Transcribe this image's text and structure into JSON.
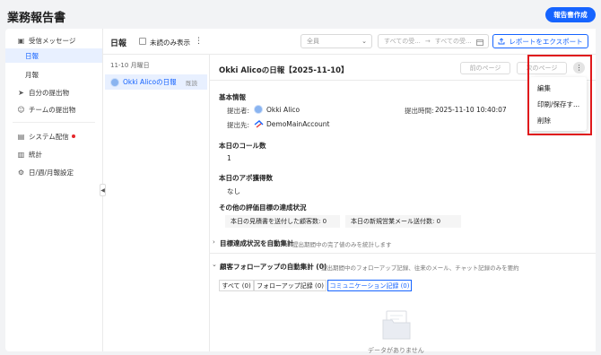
{
  "app": {
    "title": "業務報告書",
    "report_button": "報告書作成"
  },
  "sidebar": {
    "items": [
      {
        "label": "受信メッセージ",
        "icon": "inbox-icon"
      },
      {
        "label": "日報"
      },
      {
        "label": "月報"
      },
      {
        "label": "自分の提出物",
        "icon": "send-icon"
      },
      {
        "label": "チームの提出物",
        "icon": "team-icon"
      },
      {
        "label": "システム配信",
        "icon": "calendar-icon"
      },
      {
        "label": "統計",
        "icon": "stats-icon"
      },
      {
        "label": "日/週/月報設定",
        "icon": "gear-icon"
      }
    ]
  },
  "toolbar": {
    "title": "日報",
    "unread_only": "未読のみ表示",
    "member_select": "全員",
    "date_start": "すべての受...",
    "date_end": "すべての受...",
    "export": "レポートをエクスポート"
  },
  "list": {
    "date": "11-10 月曜日",
    "items": [
      {
        "name": "Okki Alicoの日報",
        "status": "既読"
      }
    ]
  },
  "report": {
    "title": "Okki Alicoの日報【2025-11-10】",
    "prev": "前のページ",
    "next": "次のページ",
    "menu": [
      "編集",
      "印刷/保存す...",
      "削除"
    ],
    "basic_info": "基本情報",
    "submitter_label": "提出者:",
    "submitter": "Okki Alico",
    "submit_time_label": "提出時間:",
    "submit_time": "2025-11-10 10:40:07",
    "recipient_label": "提出先:",
    "recipient": "DemoMainAccount",
    "call_count_label": "本日のコール数",
    "call_count": "1",
    "appt_label": "本日のアポ獲得数",
    "appt_value": "なし",
    "other_goals": "その他の評価目標の達成状況",
    "quote_sent": "本日の見積書を送付した顧客数: 0",
    "new_mail": "本日の新規営業メール送付数: 0",
    "goal_auto": "目標達成状況を自動集計",
    "goal_auto_desc": "提出期間中の完了値のみを統計します",
    "followup_auto": "顧客フォローアップの自動集計 (0)",
    "followup_desc": "提出期間中のフォローアップ記録、往来のメール、チャット記録のみを要約します",
    "tabs": [
      "すべて (0)",
      "フォローアップ記録 (0)",
      "コミュニケーション記録 (0)"
    ],
    "empty": "データがありません"
  }
}
